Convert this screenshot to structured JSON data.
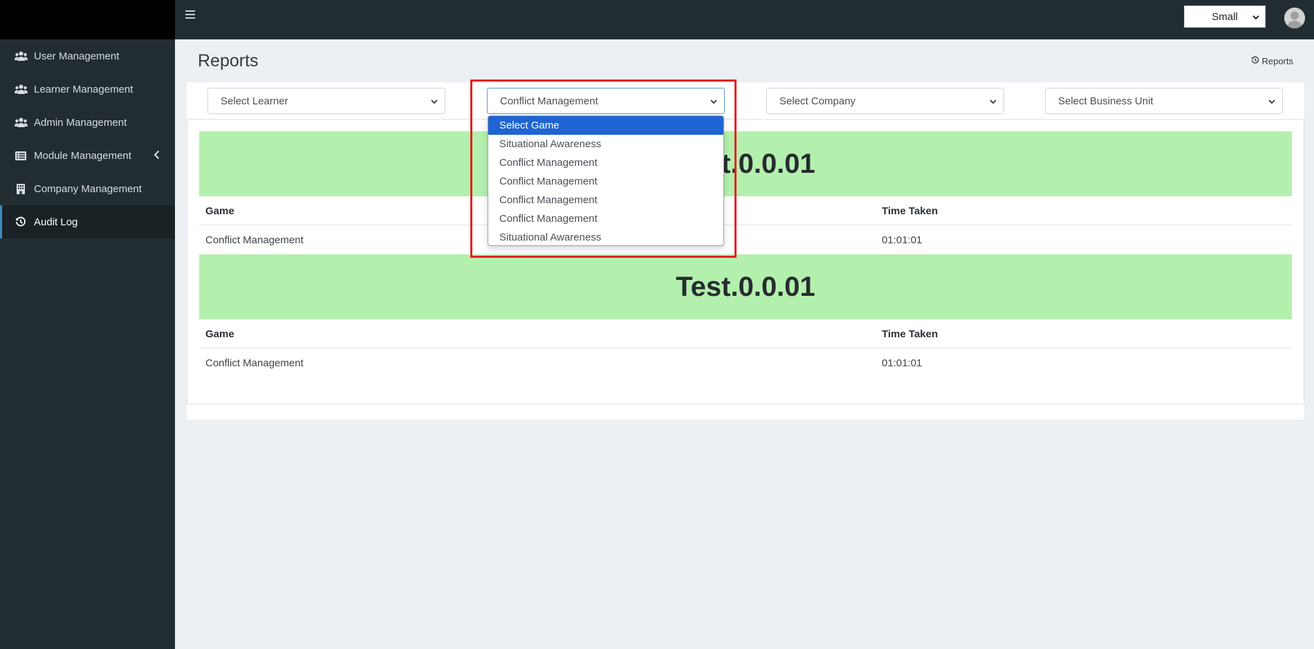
{
  "sidebar": {
    "items": [
      {
        "label": "User Management",
        "icon": "users-icon"
      },
      {
        "label": "Learner Management",
        "icon": "users-icon"
      },
      {
        "label": "Admin Management",
        "icon": "users-icon"
      },
      {
        "label": "Module Management",
        "icon": "list-icon"
      },
      {
        "label": "Company Management",
        "icon": "building-icon"
      },
      {
        "label": "Audit Log",
        "icon": "history-icon"
      }
    ]
  },
  "topbar": {
    "size_select": "Small"
  },
  "page": {
    "title": "Reports",
    "breadcrumb": "Reports"
  },
  "filters": {
    "learner": "Select Learner",
    "game": "Conflict Management",
    "company": "Select Company",
    "business_unit": "Select Business Unit"
  },
  "game_dropdown": {
    "options": [
      "Select Game",
      "Situational Awareness",
      "Conflict Management",
      "Conflict Management",
      "Conflict Management",
      "Conflict Management",
      "Situational Awareness"
    ],
    "highlighted": "Select Game"
  },
  "reports": [
    {
      "title": "Test.0.0.01",
      "col_game": "Game",
      "col_time": "Time Taken",
      "rows": [
        {
          "game": "Conflict Management",
          "time": "01:01:01"
        }
      ]
    },
    {
      "title": "Test.0.0.01",
      "col_game": "Game",
      "col_time": "Time Taken",
      "rows": [
        {
          "game": "Conflict Management",
          "time": "01:01:01"
        }
      ]
    }
  ],
  "colors": {
    "sidebar_bg": "#222d32",
    "banner_bg": "#b3f0ad",
    "highlight": "#e31e24",
    "option_selected": "#1e64d2"
  }
}
